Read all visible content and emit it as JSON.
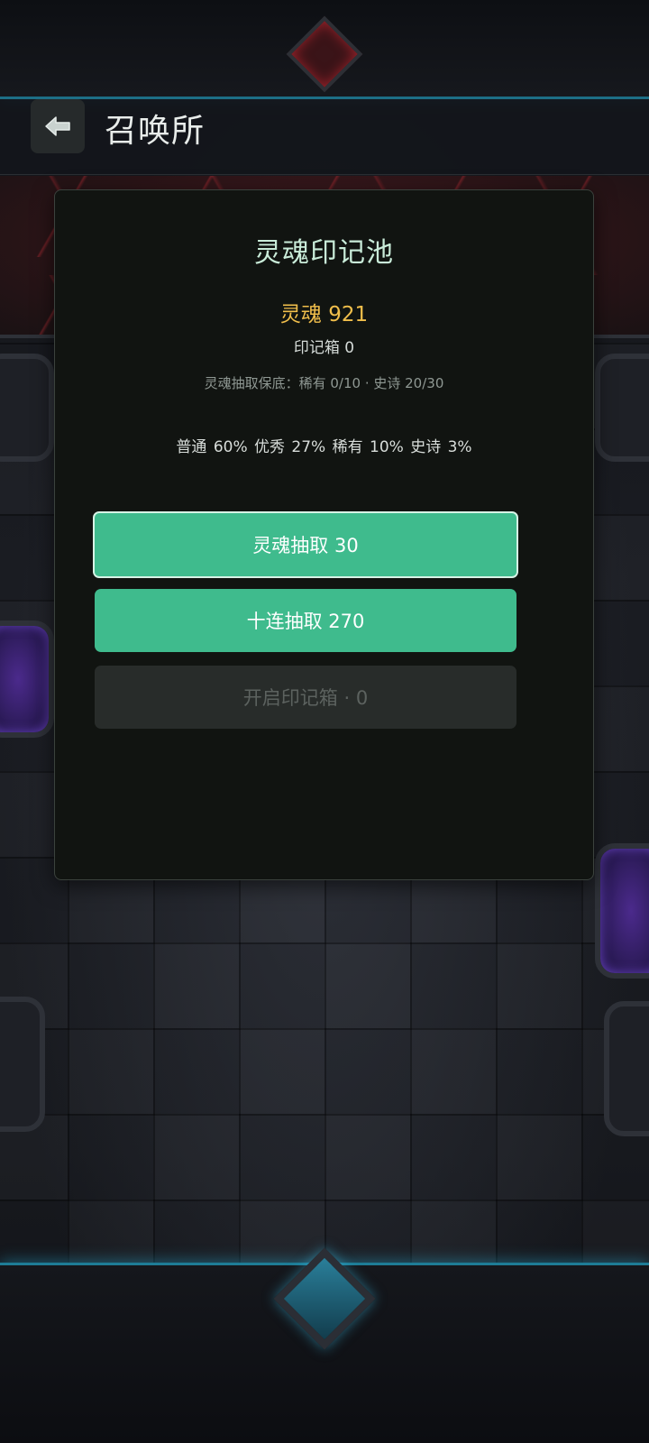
{
  "header": {
    "title": "召唤所",
    "back_icon": "arrow-left-icon"
  },
  "pool": {
    "title": "灵魂印记池",
    "soul_balance": "灵魂 921",
    "mark_box_count": "印记箱 0",
    "pity_info": "灵魂抽取保底：稀有 0/10 · 史诗 20/30",
    "rates": "普通 60%  优秀 27%  稀有 10%  史诗 3%"
  },
  "actions": {
    "single_draw": "灵魂抽取 30",
    "ten_draw": "十连抽取 270",
    "open_box": "开启印记箱 · 0"
  },
  "colors": {
    "accent_green": "#3fbb8d",
    "soul_gold": "#f0be4b",
    "title_mint": "#c9ecd9"
  }
}
